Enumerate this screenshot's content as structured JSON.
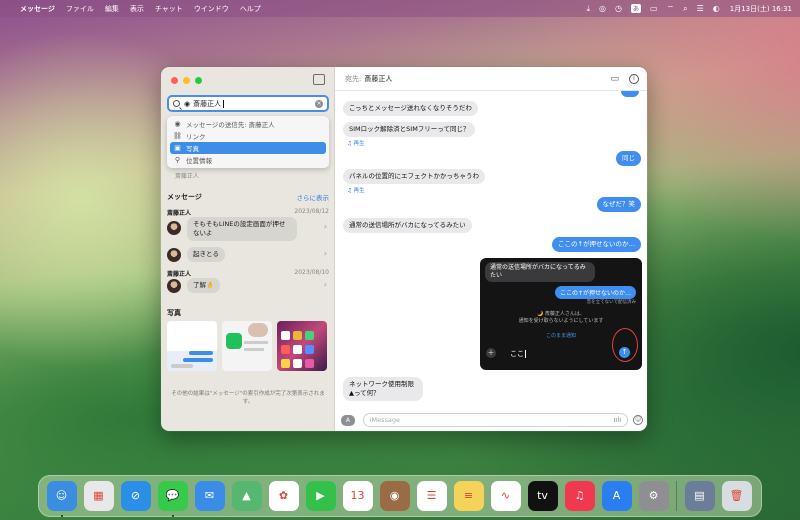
{
  "menubar": {
    "apple": "",
    "app": "メッセージ",
    "items": [
      "ファイル",
      "編集",
      "表示",
      "チャット",
      "ウインドウ",
      "ヘルプ"
    ],
    "ime": "あ",
    "clock": "1月13日(土) 16:31"
  },
  "sidebar": {
    "search_value": "斎藤正人",
    "suggestions": [
      {
        "icon": "person-icon",
        "label": "メッセージの送信先: 斎藤正人"
      },
      {
        "icon": "link-icon",
        "label": "リンク"
      },
      {
        "icon": "photo-icon",
        "label": "写真"
      },
      {
        "icon": "location-icon",
        "label": "位置情報"
      }
    ],
    "leftover_name": "斎藤正人",
    "messages_header": "メッセージ",
    "see_more": "さらに表示",
    "results": [
      {
        "name": "斎藤正人",
        "date": "2023/08/12",
        "text": "そもそもLINEの設定画面が押せないよ"
      },
      {
        "name": "",
        "date": "",
        "text": "起きとる"
      },
      {
        "name": "斎藤正人",
        "date": "2023/08/10",
        "text": "了解👌"
      }
    ],
    "photos_header": "写真",
    "footer_note": "その他の結果は\"メッセージ\"の索引作成が完了次第表示されます。"
  },
  "chat": {
    "to_label": "宛先:",
    "to_name": "斎藤正人",
    "messages": [
      {
        "dir": "recv",
        "text": "こっちとメッセージ送れなくなりそうだわ"
      },
      {
        "dir": "recv",
        "text": "SIMロック解除済とSIMフリーって同じ？"
      },
      {
        "dir": "replay",
        "text": "♫ 再生"
      },
      {
        "dir": "sent",
        "text": "同じ"
      },
      {
        "dir": "recv",
        "text": "パネルの位置的にエフェクトかかっちゃうわ"
      },
      {
        "dir": "replay",
        "text": "♫ 再生"
      },
      {
        "dir": "sent",
        "text": "なぜだ？笑"
      },
      {
        "dir": "recv",
        "text": "通常の送信場所がバカになってるみたい"
      },
      {
        "dir": "sent",
        "text": "ここの↑が押せないのか…"
      },
      {
        "dir": "recv",
        "text": "ネットワーク使用制限▲って何？"
      }
    ],
    "screenshot": {
      "recv": "通常の送信場所がバカになってるみたい",
      "sent": "ここの↑が押せないのか…",
      "hint": "音を立てないで配信済み",
      "dnd": "🌙 斎藤正人さんは、\n通知を受け取らないようにしています",
      "dnd_link": "このまま通知",
      "typed": "ここ"
    },
    "input_placeholder": "iMessage"
  },
  "dock": [
    {
      "name": "finder-icon",
      "color": "#3b8de0",
      "glyph": "☺"
    },
    {
      "name": "launchpad-icon",
      "color": "#e8e8e8",
      "glyph": "▦"
    },
    {
      "name": "safari-icon",
      "color": "#2b8fe8",
      "glyph": "⊘"
    },
    {
      "name": "messages-icon",
      "color": "#36c94a",
      "glyph": "💬"
    },
    {
      "name": "mail-icon",
      "color": "#3a8de6",
      "glyph": "✉"
    },
    {
      "name": "maps-icon",
      "color": "#56b870",
      "glyph": "▲"
    },
    {
      "name": "photos-icon",
      "color": "#ffffff",
      "glyph": "✿"
    },
    {
      "name": "facetime-icon",
      "color": "#33c14a",
      "glyph": "▶"
    },
    {
      "name": "calendar-icon",
      "color": "#ffffff",
      "glyph": "13"
    },
    {
      "name": "contacts-icon",
      "color": "#9a6b45",
      "glyph": "◉"
    },
    {
      "name": "reminders-icon",
      "color": "#ffffff",
      "glyph": "☰"
    },
    {
      "name": "notes-icon",
      "color": "#f5d25a",
      "glyph": "≡"
    },
    {
      "name": "freeform-icon",
      "color": "#ffffff",
      "glyph": "∿"
    },
    {
      "name": "apple-tv-icon",
      "color": "#111111",
      "glyph": "tv"
    },
    {
      "name": "music-icon",
      "color": "#f0394e",
      "glyph": "♫"
    },
    {
      "name": "app-store-icon",
      "color": "#2a7ef0",
      "glyph": "A"
    },
    {
      "name": "system-settings-icon",
      "color": "#8e8e93",
      "glyph": "⚙"
    },
    {
      "sep": true
    },
    {
      "name": "downloads-stack-icon",
      "color": "#6b7d99",
      "glyph": "▤"
    },
    {
      "name": "trash-icon",
      "color": "#d8dde2",
      "glyph": "🗑"
    }
  ]
}
